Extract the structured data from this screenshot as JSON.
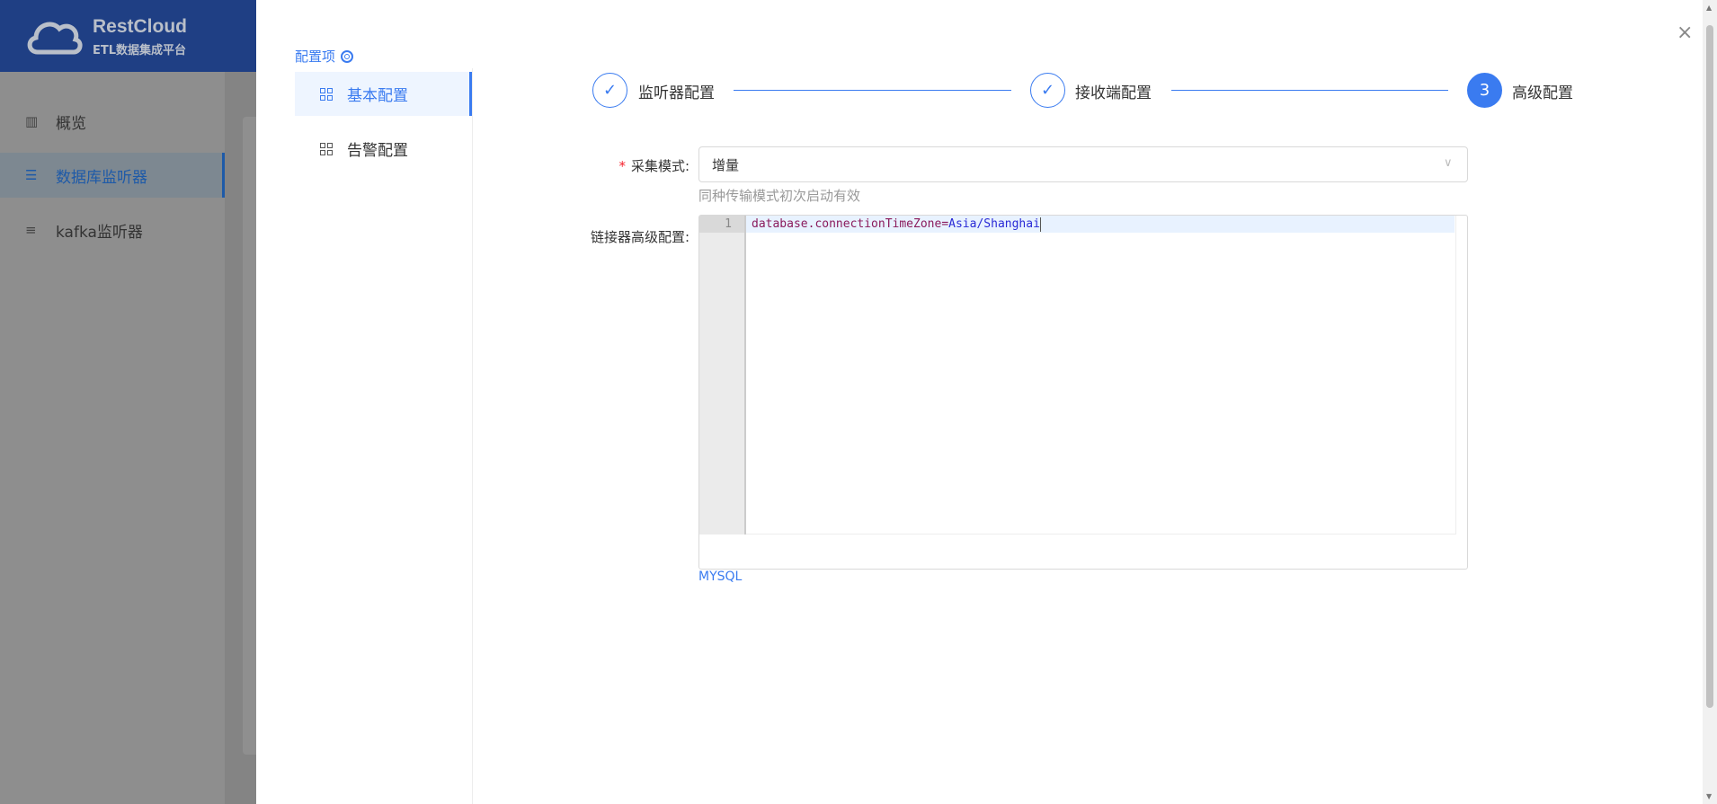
{
  "brand": {
    "name": "RestCloud",
    "subtitle": "ETL数据集成平台"
  },
  "sidebar": {
    "items": [
      {
        "label": "概览",
        "icon": "bar-chart-icon"
      },
      {
        "label": "数据库监听器",
        "icon": "database-icon",
        "active": true
      },
      {
        "label": "kafka监听器",
        "icon": "list-icon"
      }
    ]
  },
  "drawer": {
    "config_title": "配置项",
    "menu": [
      {
        "label": "基本配置",
        "active": true
      },
      {
        "label": "告警配置"
      }
    ],
    "steps": [
      {
        "label": "监听器配置",
        "status": "done"
      },
      {
        "label": "接收端配置",
        "status": "done"
      },
      {
        "label": "高级配置",
        "number": "3",
        "status": "current"
      }
    ],
    "form": {
      "collect_mode_label": "采集模式:",
      "required_mark": "*",
      "collect_mode_value": "增量",
      "collect_mode_hint": "同种传输模式初次启动有效",
      "connector_label": "链接器高级配置:",
      "editor_line_number": "1",
      "editor_key": "database.connectionTimeZone=",
      "editor_value": "Asia/Shanghai",
      "db_type": "MYSQL"
    },
    "close_icon": "×"
  }
}
